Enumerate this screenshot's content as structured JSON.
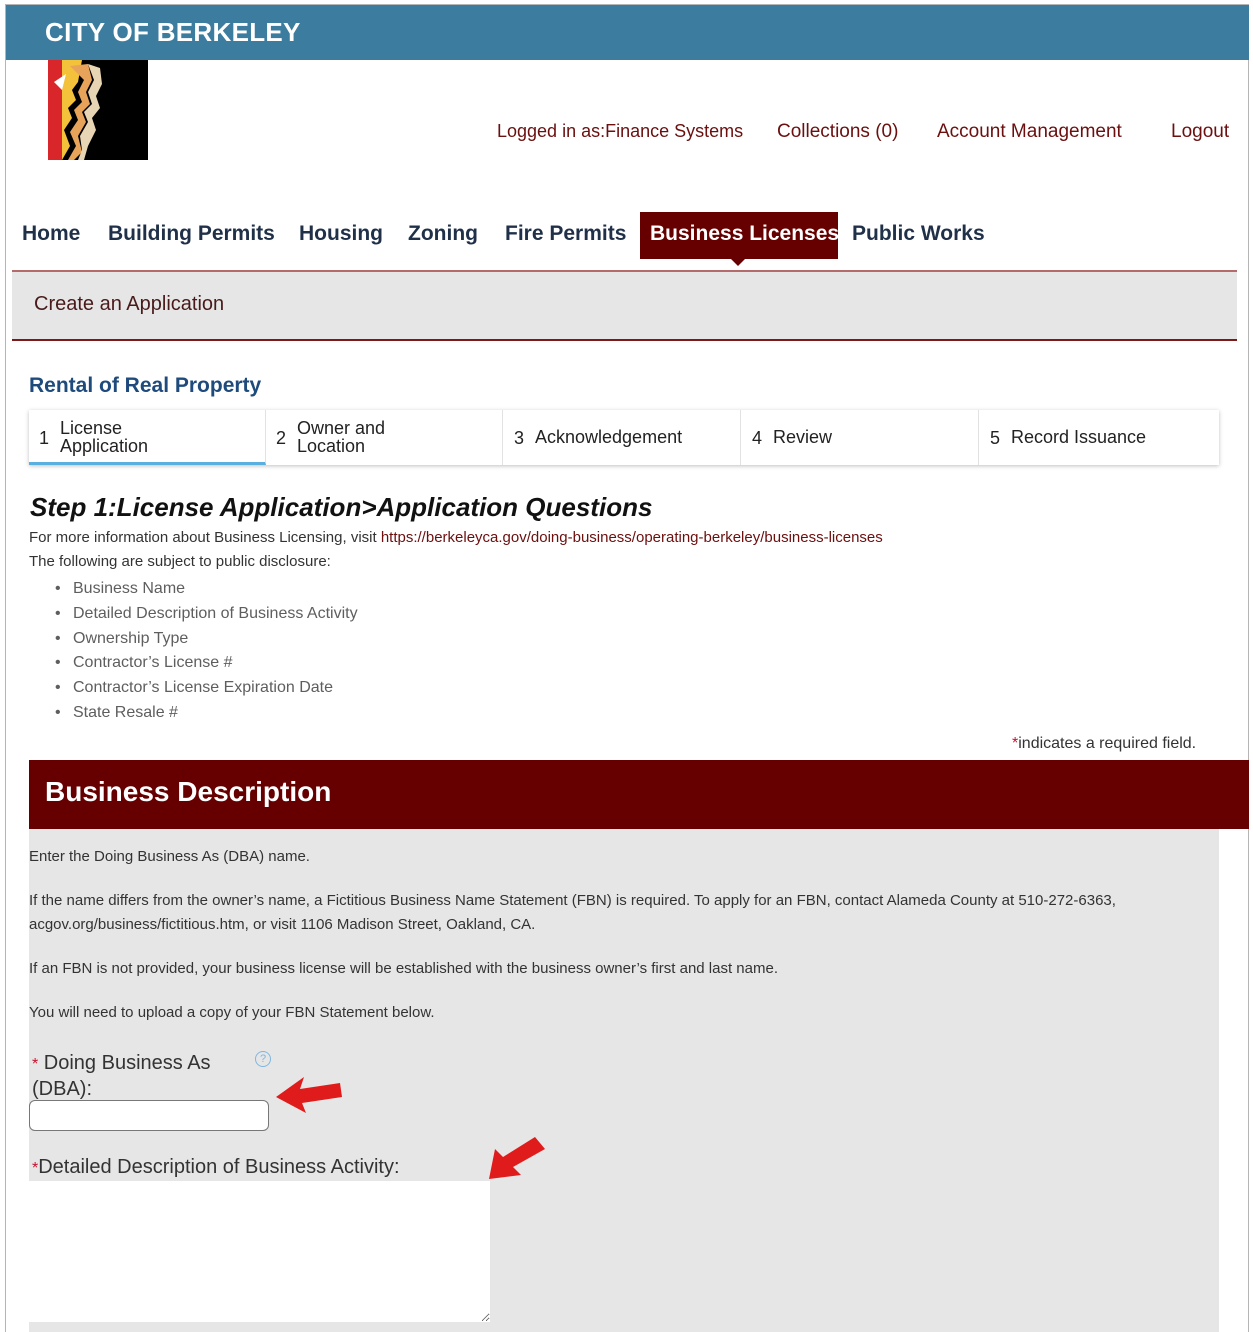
{
  "header": {
    "city_name": "CITY OF BERKELEY",
    "logged_in": "Logged in as:Finance Systems",
    "collections": "Collections (0)",
    "account_management": "Account Management",
    "logout": "Logout"
  },
  "nav": {
    "home": "Home",
    "building_permits": "Building Permits",
    "housing": "Housing",
    "zoning": "Zoning",
    "fire_permits": "Fire Permits",
    "business_licenses": "Business Licenses",
    "public_works": "Public Works"
  },
  "subheader": {
    "create_application": "Create an Application"
  },
  "record_type": "Rental of Real Property",
  "steps": [
    {
      "num": "1",
      "line1": "License",
      "line2": "Application"
    },
    {
      "num": "2",
      "line1": "Owner and",
      "line2": "Location"
    },
    {
      "num": "3",
      "label": "Acknowledgement"
    },
    {
      "num": "4",
      "label": "Review"
    },
    {
      "num": "5",
      "label": "Record Issuance"
    }
  ],
  "step_title": "Step 1:License Application>Application Questions",
  "info": {
    "more_info_prefix": "For more information about Business Licensing, visit ",
    "more_info_link": "https://berkeleyca.gov/doing-business/operating-berkeley/business-licenses",
    "disclosure": "The following are subject to public disclosure:"
  },
  "disclosure_items": [
    "Business Name",
    "Detailed Description of Business Activity",
    "Ownership Type",
    "Contractor’s License #",
    "Contractor’s License Expiration Date",
    "State Resale #"
  ],
  "required_note": {
    "star": "*",
    "text": "indicates a required field."
  },
  "section": {
    "title": "Business Description",
    "p1": "Enter the Doing Business As (DBA) name.",
    "p2": "If the name differs from the owner’s name, a Fictitious Business Name Statement (FBN) is required. To apply for an FBN, contact Alameda County at 510-272-6363, acgov.org/business/fictitious.htm, or visit 1106 Madison Street, Oakland, CA.",
    "p3": "If an FBN is not provided, your business license will be established with the business owner’s first and last name.",
    "p4": "You will need to upload a copy of your FBN Statement below."
  },
  "fields": {
    "dba_star": "*",
    "dba_label_1": "Doing Business As",
    "dba_label_2": "(DBA):",
    "dba_value": "",
    "desc_star": "*",
    "desc_label": "Detailed Description of Business Activity:",
    "desc_value": ""
  },
  "icons": {
    "help": "help-circle-icon",
    "annotation_arrow": "red-arrow-icon"
  },
  "colors": {
    "topbar": "#3c7c9e",
    "brand_maroon": "#660000",
    "link": "#6b0f0f",
    "required": "#c8102e",
    "panel_bg": "#e6e6e6"
  }
}
